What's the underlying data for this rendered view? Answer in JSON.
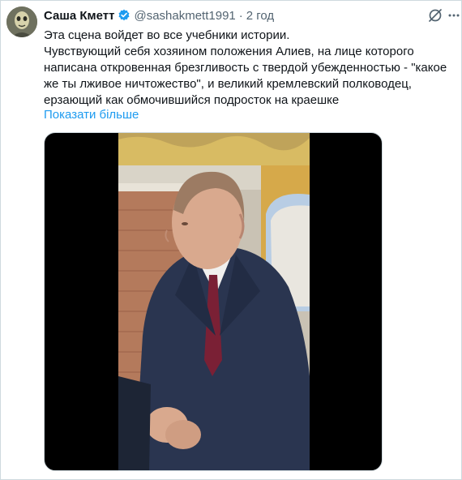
{
  "tweet": {
    "author_name": "Саша Кметт",
    "handle": "@sashakmett1991",
    "separator": "·",
    "time": "2 год",
    "text_lines": [
      "Эта сцена войдет во все учебники истории.",
      "Чувствующий себя хозяином положения Алиев, на лице которого",
      "написана откровенная брезгливость с твердой убежденностью - \"какое",
      "же ты лживое ничтожество\", и великий кремлевский полководец,",
      "ерзающий  как обмочившийся подросток на краешке"
    ],
    "show_more": "Показати більше"
  },
  "icons": {
    "verified": "verified-badge-icon",
    "grok": "grok-icon",
    "more": "more-options-icon"
  },
  "colors": {
    "accent": "#1d9bf0",
    "text": "#0f1419",
    "secondary": "#536471"
  }
}
